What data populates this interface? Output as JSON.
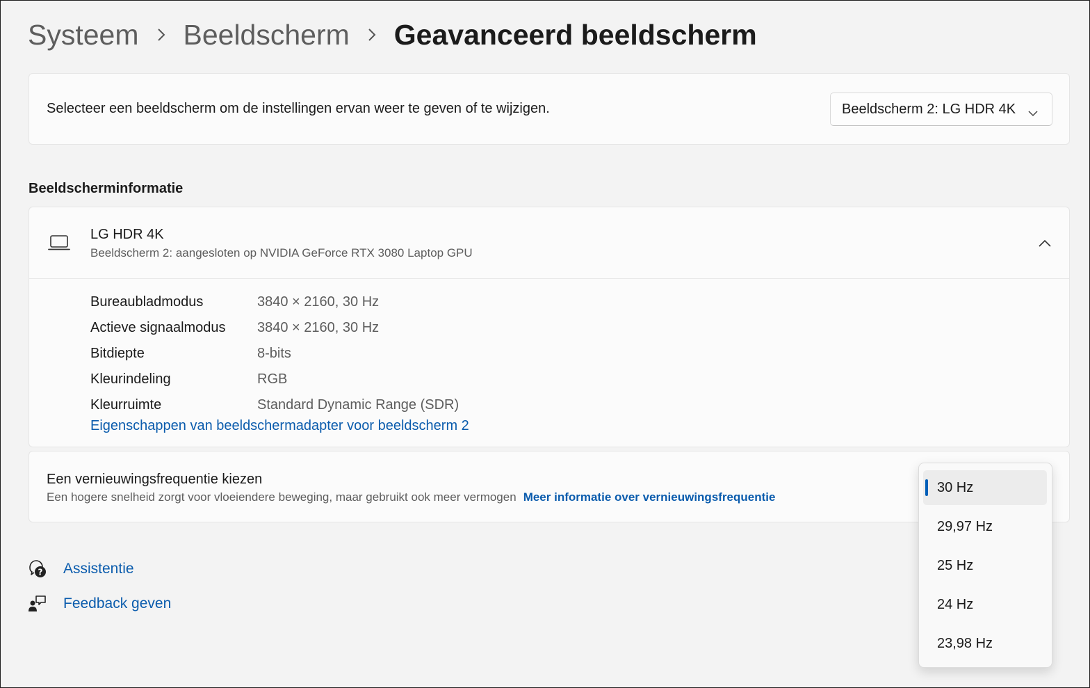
{
  "breadcrumb": {
    "items": [
      "Systeem",
      "Beeldscherm"
    ],
    "current": "Geavanceerd beeldscherm",
    "separator_icon": "chevron-right-icon"
  },
  "display_select": {
    "label": "Selecteer een beeldscherm om de instellingen ervan weer te geven of te wijzigen.",
    "selected": "Beeldscherm 2: LG HDR 4K",
    "icon": "chevron-down-icon"
  },
  "display_info": {
    "section_title": "Beeldscherminformatie",
    "icon": "laptop-icon",
    "expand_icon": "chevron-up-icon",
    "name": "LG HDR 4K",
    "subtitle": "Beeldscherm 2: aangesloten op NVIDIA GeForce RTX 3080 Laptop GPU",
    "rows": [
      {
        "label": "Bureaubladmodus",
        "value": "3840 × 2160, 30 Hz"
      },
      {
        "label": "Actieve signaalmodus",
        "value": "3840 × 2160, 30 Hz"
      },
      {
        "label": "Bitdiepte",
        "value": "8-bits"
      },
      {
        "label": "Kleurindeling",
        "value": "RGB"
      },
      {
        "label": "Kleurruimte",
        "value": "Standard Dynamic Range (SDR)"
      }
    ],
    "adapter_link": "Eigenschappen van beeldschermadapter voor beeldscherm 2"
  },
  "refresh_rate": {
    "title": "Een vernieuwingsfrequentie kiezen",
    "description": "Een hogere snelheid zorgt voor vloeiendere beweging, maar gebruikt ook meer vermogen",
    "link": "Meer informatie over vernieuwingsfrequentie",
    "options": [
      "30 Hz",
      "29,97 Hz",
      "25 Hz",
      "24 Hz",
      "23,98 Hz"
    ],
    "selected": "30 Hz"
  },
  "help": {
    "items": [
      {
        "label": "Assistentie",
        "icon": "help-chat-icon"
      },
      {
        "label": "Feedback geven",
        "icon": "feedback-icon"
      }
    ]
  },
  "colors": {
    "background": "#f3f3f3",
    "card": "#fbfbfb",
    "link": "#0b5cad",
    "accent": "#005fb8",
    "secondary_text": "#5d5d5d"
  }
}
